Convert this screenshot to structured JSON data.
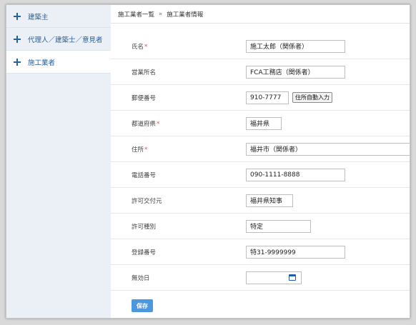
{
  "sidebar": {
    "items": [
      {
        "label": "建築主"
      },
      {
        "label": "代理人／建築士／意見者"
      },
      {
        "label": "施工業者"
      }
    ]
  },
  "breadcrumb": {
    "parent": "施工業者一覧",
    "separator": "»",
    "current": "施工業者情報"
  },
  "form": {
    "name": {
      "label": "氏名",
      "required": "*",
      "value": "施工太郎（関係者）"
    },
    "office": {
      "label": "営業所名",
      "value": "FCA工務店（関係者）"
    },
    "zip": {
      "label": "郵便番号",
      "value": "910-7777",
      "button": "住所自動入力"
    },
    "prefecture": {
      "label": "都道府県",
      "required": "*",
      "value": "福井県"
    },
    "address": {
      "label": "住所",
      "required": "*",
      "value": "福井市（関係者）"
    },
    "phone": {
      "label": "電話番号",
      "value": "090-1111-8888"
    },
    "issuer": {
      "label": "許可交付元",
      "value": "福井県知事"
    },
    "permit_type": {
      "label": "許可種別",
      "value": "特定"
    },
    "reg_no": {
      "label": "登録番号",
      "value": "特31-9999999"
    },
    "expiry": {
      "label": "無効日",
      "value": ""
    }
  },
  "actions": {
    "save": "保存"
  },
  "colors": {
    "accent": "#4c97dd",
    "link": "#2a5f9e",
    "required": "#d9534f",
    "sidebar_bg": "#eaf0f5"
  }
}
